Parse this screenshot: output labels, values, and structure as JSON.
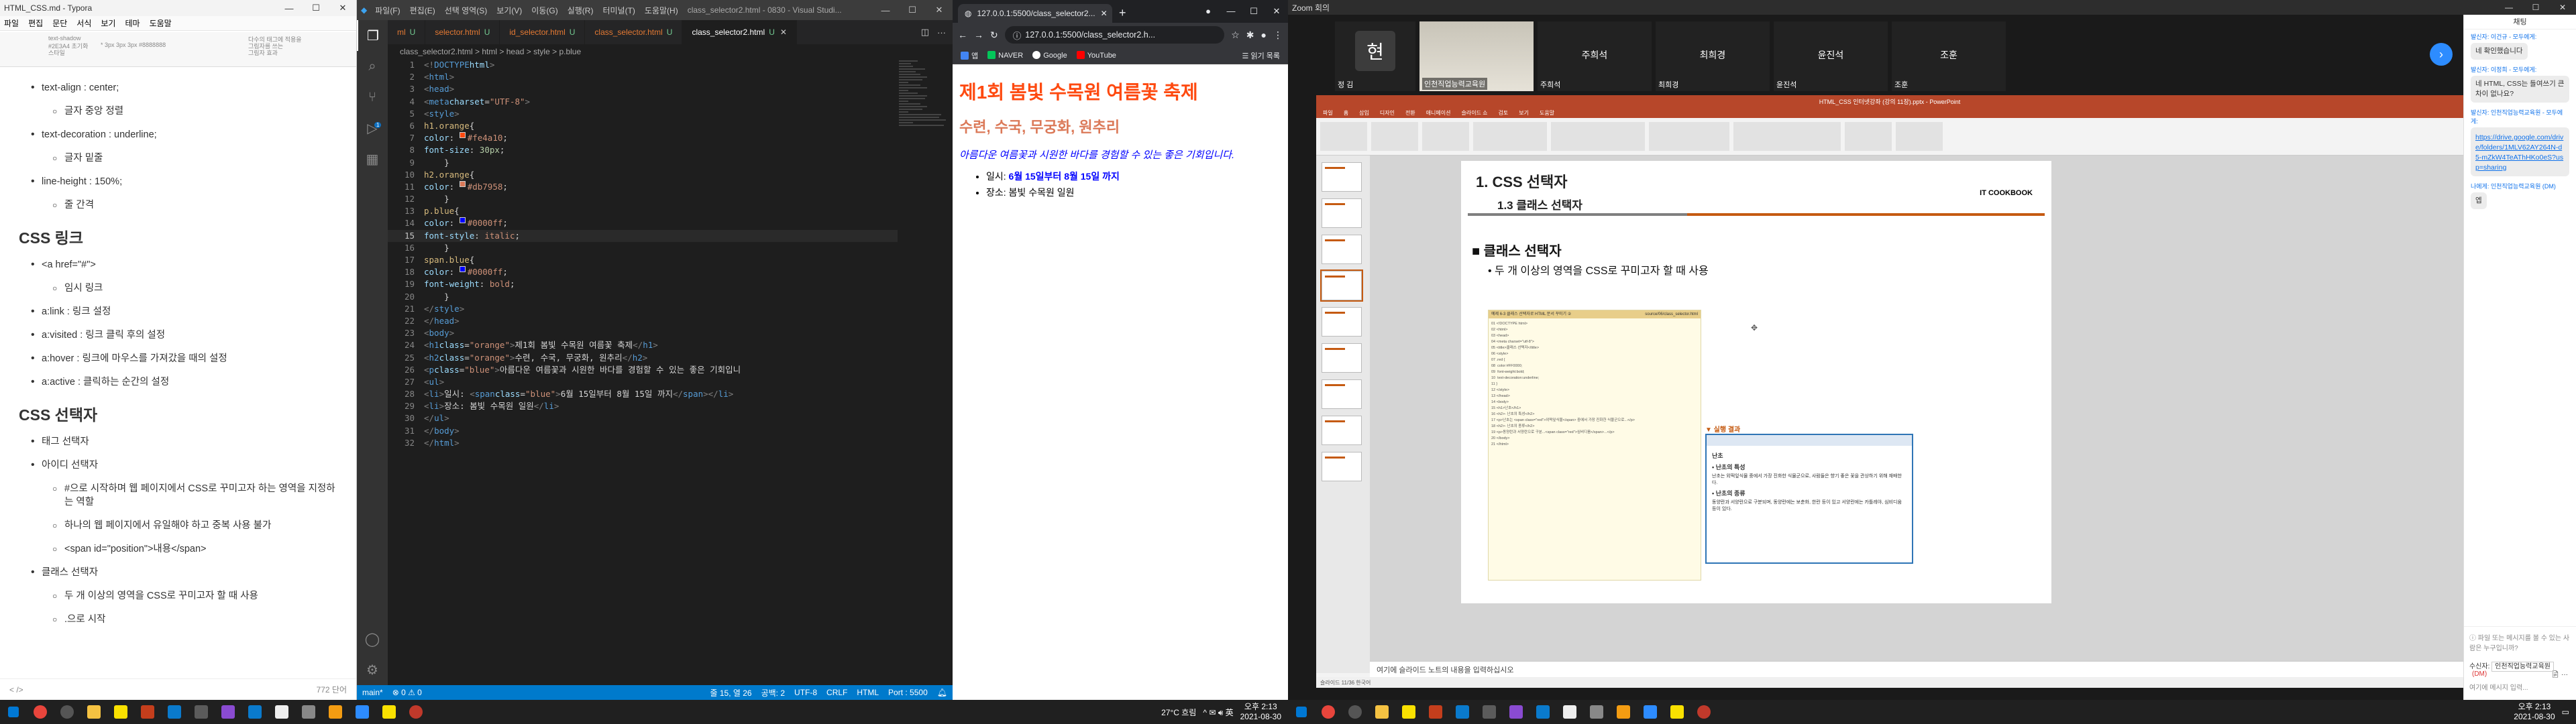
{
  "typora": {
    "title": "HTML_CSS.md - Typora",
    "menu": [
      "파일",
      "편집",
      "문단",
      "서식",
      "보기",
      "테마",
      "도움말"
    ],
    "outline_snippets": [
      "text-shadow",
      "#2E3A4 초기화",
      "스타일",
      "* 3px 3px 3px #8888888",
      "다수의 태그에 적용을",
      "그림자를 쓰는",
      "그림자 효과"
    ],
    "items": [
      {
        "t": "text-align : center;",
        "sub": false
      },
      {
        "t": "글자 중앙 정렬",
        "sub": true
      },
      {
        "t": "text-decoration : underline;",
        "sub": false
      },
      {
        "t": "글자 밑줄",
        "sub": true
      },
      {
        "t": "line-height : 150%;",
        "sub": false
      },
      {
        "t": "줄 간격",
        "sub": true
      }
    ],
    "h_link": "CSS 링크",
    "link_items": [
      {
        "t": "<a href=\"#\">",
        "sub": false
      },
      {
        "t": "임시 링크",
        "sub": true
      },
      {
        "t": "a:link : 링크 설정",
        "sub": false
      },
      {
        "t": "a:visited : 링크 클릭 후의 설정",
        "sub": false
      },
      {
        "t": "a:hover : 링크에 마우스를 가져갔을 때의 설정",
        "sub": false
      },
      {
        "t": "a:active : 클릭하는 순간의 설정",
        "sub": false
      }
    ],
    "h_sel": "CSS 선택자",
    "sel_items": [
      {
        "t": "태그 선택자",
        "sub": false
      },
      {
        "t": "아이디 선택자",
        "sub": false
      },
      {
        "t": "#으로 시작하며 웹 페이지에서 CSS로 꾸미고자 하는 영역을 지정하는 역할",
        "sub": true
      },
      {
        "t": "하나의 웹 페이지에서 유일해야 하고 중복 사용 불가",
        "sub": true
      },
      {
        "t": "<span id=\"position\">내용</span>",
        "sub": true
      },
      {
        "t": "클래스 선택자",
        "sub": false
      },
      {
        "t": "두 개 이상의 영역을 CSS로 꾸미고자 할 때 사용",
        "sub": true
      },
      {
        "t": ".으로 시작",
        "sub": true
      }
    ],
    "status_left": "< />",
    "status_right": "772 단어"
  },
  "vscode": {
    "title": "class_selector2.html - 0830 - Visual Studi...",
    "menu": [
      "파일(F)",
      "편집(E)",
      "선택 영역(S)",
      "보기(V)",
      "이동(G)",
      "실행(R)",
      "터미널(T)",
      "도움말(H)"
    ],
    "tabs": [
      {
        "label": "ml",
        "mark": "U"
      },
      {
        "label": "selector.html",
        "mark": "U"
      },
      {
        "label": "id_selector.html",
        "mark": "U"
      },
      {
        "label": "class_selector.html",
        "mark": "U"
      },
      {
        "label": "class_selector2.html",
        "mark": "U"
      }
    ],
    "breadcrumb": "class_selector2.html > html > head > style > p.blue",
    "status": {
      "branch": "main*",
      "problems": "⊗ 0 ⚠ 0",
      "position": "줄 15, 열 26",
      "spaces": "공백: 2",
      "encoding": "UTF-8",
      "eol": "CRLF",
      "lang": "HTML",
      "port": "Port : 5500"
    }
  },
  "chrome": {
    "tab_title": "127.0.0.1:5500/class_selector2...",
    "url": "127.0.0.1:5500/class_selector2.h...",
    "bookmarks": [
      "앱",
      "NAVER",
      "Google",
      "YouTube"
    ],
    "reading_list": "읽기 목록",
    "h1": "제1회 봄빛 수목원 여름꽃 축제",
    "h2": "수련, 수국, 무궁화, 원추리",
    "p": "아름다운 여름꽃과 시원한 바다를 경험할 수 있는 좋은 기회입니다.",
    "li1_prefix": "일시: ",
    "li1_date": "6월 15일부터 8월 15일 까지",
    "li2": "장소: 봄빛 수목원 일원"
  },
  "taskbar_left": {
    "weather": "27°C 흐림",
    "time": "오후 2:13",
    "date": "2021-08-30"
  },
  "taskbar_right": {
    "time": "오후 2:13",
    "date": "2021-08-30"
  },
  "zoom": {
    "title": "Zoom 회의",
    "tiles": [
      {
        "name": "정 김",
        "label": "현"
      },
      {
        "name": "인천직업능력교육원",
        "label": ""
      },
      {
        "name": "주희석",
        "label": "주희석"
      },
      {
        "name": "최희경",
        "label": "최희경"
      },
      {
        "name": "윤진석",
        "label": "윤진석"
      },
      {
        "name": "조훈",
        "label": "조훈"
      }
    ],
    "ppt": {
      "title": "HTML_CSS 인터넷강좌 (강의 11장).pptx - PowerPoint",
      "tabs": [
        "파일",
        "홈",
        "삽입",
        "디자인",
        "전환",
        "애니메이션",
        "슬라이드 쇼",
        "검토",
        "보기",
        "도움말"
      ],
      "slide_h1": "1. CSS 선택자",
      "slide_h2": "1.3 클래스 선택자",
      "logo": "IT COOKBOOK",
      "sq": "■ 클래스 선택자",
      "bullet": "• 두 개 이상의 영역을 CSS로 꾸미고자 할 때 사용",
      "code_head": "예제 6-3  클래스 선택자로 HTML 문서 꾸미기 ②",
      "code_file": "source/06/class_selector.html",
      "result_label": "▼ 실행 결과",
      "result_title": "난초",
      "result_sub1": "• 난초의 특성",
      "result_sub2": "• 난초의 종류",
      "notes": "여기에 슬라이드 노트의 내용을 입력하십시오",
      "status": "슬라이드 11/36  한국어"
    },
    "chat": {
      "header": "채팅",
      "messages": [
        {
          "from": "발신자: 이건규 - 모두에게:",
          "text": "네 확인했습니다",
          "link": false
        },
        {
          "from": "발신자: 이정희 - 모두에게:",
          "text": "네 HTML, CSS는 들여쓰기 큰 차이 없나요?",
          "link": false
        },
        {
          "from": "발신자: 인천직업능력교육원 - 모두에게:",
          "text": "https://drive.google.com/drive/folders/1MLV62AY264N-d5-mZkW4TeAThHKo0eS?usp=sharing",
          "link": true
        },
        {
          "from": "나에게: 인천직업능력교육원 (DM)",
          "text": "엡",
          "link": false
        }
      ],
      "file_hint": "파일 또는 메시지를 볼 수 있는 사람은 누구입니까?",
      "to_label": "수신자:",
      "to_value": "인천직업능력교육원",
      "to_dm": "(DM)",
      "placeholder": "여기에 메시지 입력..."
    }
  }
}
